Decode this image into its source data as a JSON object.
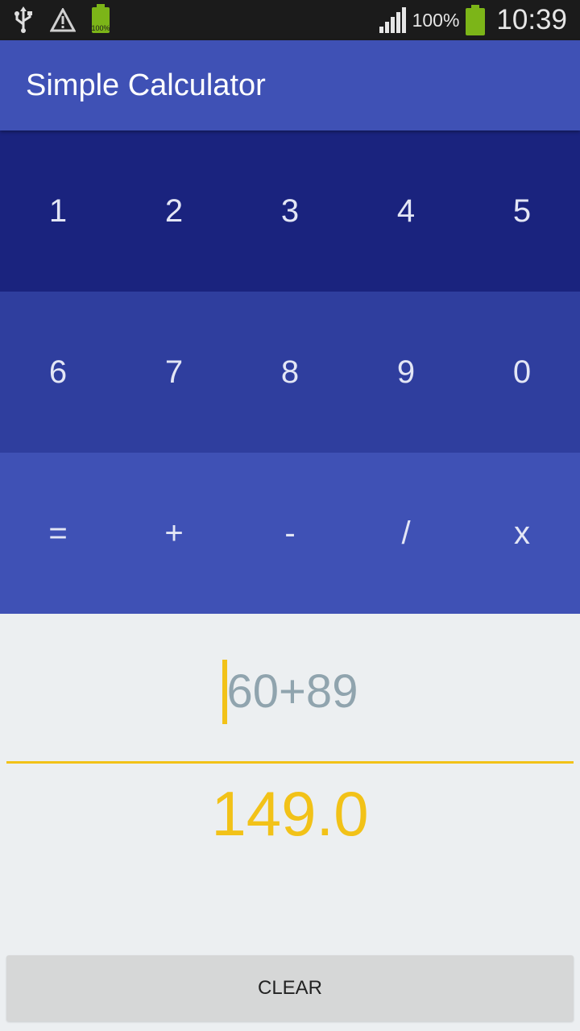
{
  "status_bar": {
    "icons": [
      "usb-icon",
      "warning-icon",
      "battery-small-icon",
      "signal-icon",
      "battery-icon"
    ],
    "small_battery_label": "100%",
    "battery_percent": "100%",
    "time": "10:39"
  },
  "app_bar": {
    "title": "Simple Calculator"
  },
  "keypad": {
    "row1": [
      "1",
      "2",
      "3",
      "4",
      "5"
    ],
    "row2": [
      "6",
      "7",
      "8",
      "9",
      "0"
    ],
    "row3": [
      "=",
      "+",
      "-",
      "/",
      "x"
    ]
  },
  "display": {
    "expression": "60+89",
    "result": "149.0"
  },
  "clear_button": {
    "label": "CLEAR"
  },
  "colors": {
    "app_bar": "#3f51b5",
    "row1": "#1a237e",
    "row2": "#2f3e9e",
    "row3": "#3f51b5",
    "accent": "#f2c218",
    "expression_text": "#90a4ae",
    "background": "#eceff1"
  }
}
